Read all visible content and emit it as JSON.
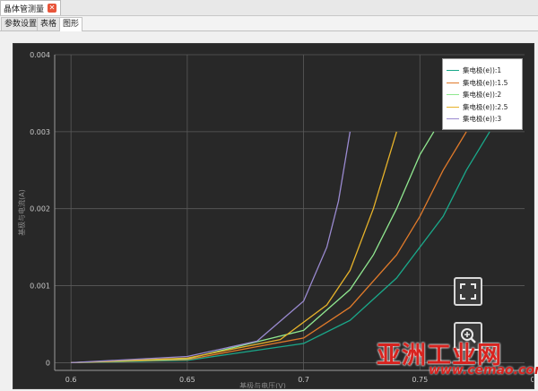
{
  "document_tab": {
    "title": "晶体管测量"
  },
  "subtabs": [
    {
      "label": "参数设置"
    },
    {
      "label": "表格"
    },
    {
      "label": "图形"
    }
  ],
  "chart_data": {
    "type": "line",
    "title": "",
    "xlabel": "基极与电压(V)",
    "ylabel": "基极与电流(A)",
    "xlim": [
      0.593,
      0.795
    ],
    "ylim": [
      -0.0001,
      0.004
    ],
    "x_ticks": [
      "0.6",
      "0.65",
      "0.7",
      "0.75",
      "0.8"
    ],
    "y_ticks": [
      "0",
      "0.001",
      "0.002",
      "0.003",
      "0.004"
    ],
    "grid": true,
    "legend_position": "top-right",
    "series": [
      {
        "name": "集电极(e)):1",
        "color": "#1aa88a",
        "x": [
          0.6,
          0.65,
          0.7,
          0.72,
          0.74,
          0.76,
          0.77,
          0.78
        ],
        "y": [
          0.0,
          3e-05,
          0.00025,
          0.00055,
          0.0011,
          0.0019,
          0.0025,
          0.003
        ]
      },
      {
        "name": "集电极(e)):1.5",
        "color": "#e07a2a",
        "x": [
          0.6,
          0.65,
          0.7,
          0.72,
          0.74,
          0.75,
          0.76,
          0.77
        ],
        "y": [
          0.0,
          4e-05,
          0.00032,
          0.00072,
          0.0014,
          0.0019,
          0.0025,
          0.003
        ]
      },
      {
        "name": "集电极(e)):2",
        "color": "#90e890",
        "x": [
          0.6,
          0.65,
          0.7,
          0.72,
          0.73,
          0.74,
          0.75,
          0.756
        ],
        "y": [
          0.0,
          5e-05,
          0.00042,
          0.00095,
          0.0014,
          0.002,
          0.0027,
          0.003
        ]
      },
      {
        "name": "集电极(e)):2.5",
        "color": "#e6b22a",
        "x": [
          0.6,
          0.65,
          0.69,
          0.71,
          0.72,
          0.73,
          0.74
        ],
        "y": [
          0.0,
          6e-05,
          0.0003,
          0.00075,
          0.0012,
          0.002,
          0.003
        ]
      },
      {
        "name": "集电极(e)):3",
        "color": "#9a8ad0",
        "x": [
          0.6,
          0.65,
          0.68,
          0.7,
          0.71,
          0.715,
          0.72
        ],
        "y": [
          0.0,
          8e-05,
          0.00028,
          0.0008,
          0.0015,
          0.0021,
          0.003
        ]
      }
    ]
  },
  "colors": {
    "plot_background": "#282828",
    "grid": "#5a5a5a",
    "axis": "#9a9a9a",
    "tick_label": "#c8c8c8",
    "accent_close": "#e8553a"
  },
  "tools": {
    "fit_icon": "fullscreen-icon",
    "zoom_icon": "zoom-icon"
  },
  "watermark": {
    "text": "亚洲工业网",
    "url": "www.cemao.com"
  }
}
